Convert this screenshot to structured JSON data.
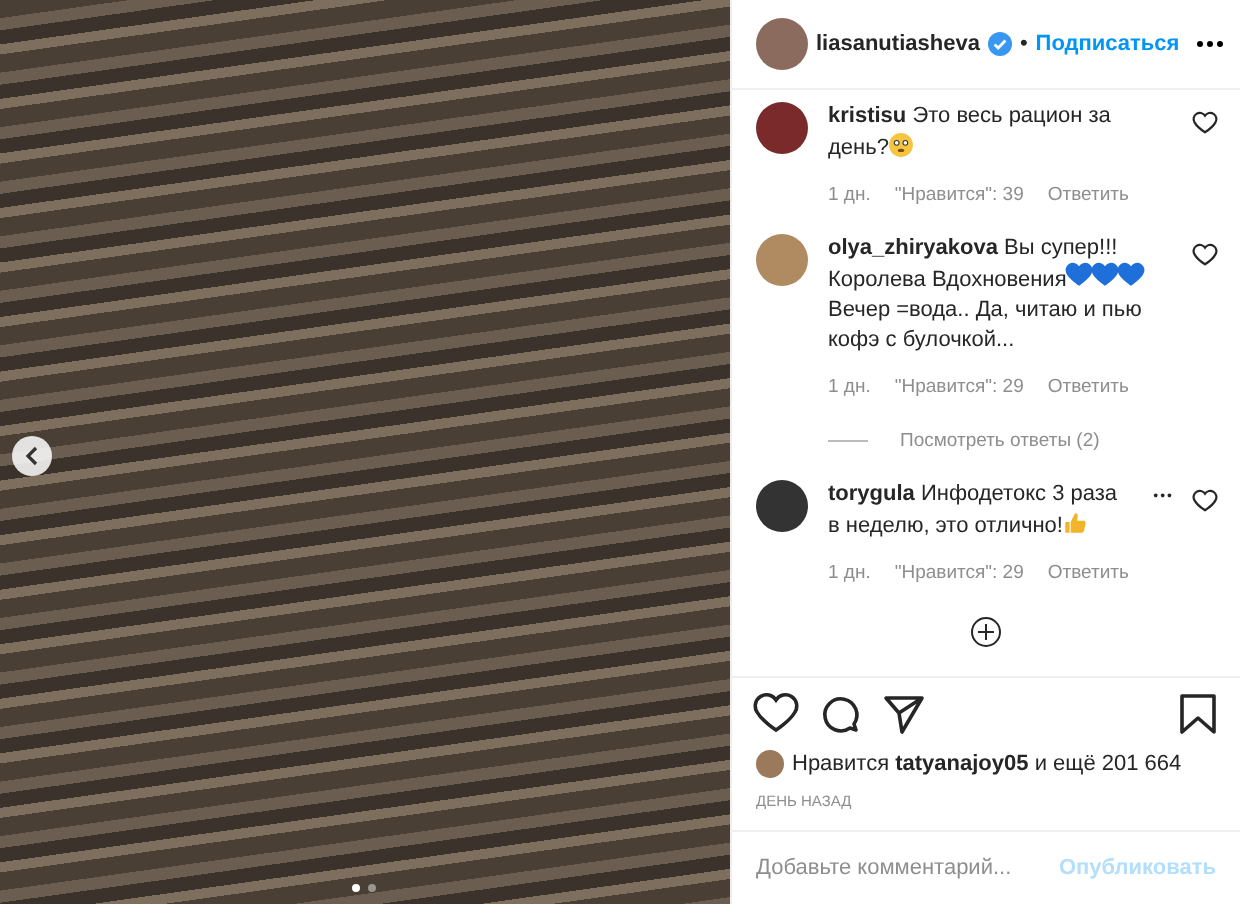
{
  "photo": {
    "dots": [
      {
        "selected": true
      },
      {
        "selected": false
      }
    ]
  },
  "header": {
    "username": "liasanutiasheva",
    "verified": true,
    "separator": "•",
    "follow": "Подписаться"
  },
  "comments": [
    {
      "username": "kristisu",
      "parts": [
        {
          "kind": "text",
          "text": "Это весь рацион за день?"
        },
        {
          "kind": "face"
        }
      ],
      "time": "1 дн.",
      "likes": "\"Нравится\": 39",
      "reply": "Ответить",
      "liked": false
    },
    {
      "username": "olya_zhiryakova",
      "parts": [
        {
          "kind": "text",
          "text": "Вы супер!!! Королева Вдохновения"
        },
        {
          "kind": "heart"
        },
        {
          "kind": "heart"
        },
        {
          "kind": "heart"
        },
        {
          "kind": "text",
          "text": " Вечер =вода.. Да, читаю и пью кофэ с булочкой..."
        }
      ],
      "time": "1 дн.",
      "likes": "\"Нравится\": 29",
      "reply": "Ответить",
      "liked": false,
      "view_replies": "Посмотреть ответы (2)"
    },
    {
      "username": "torygula",
      "parts": [
        {
          "kind": "text",
          "text": "Инфодетокс 3 раза в неделю, это отлично!"
        },
        {
          "kind": "thumbs"
        }
      ],
      "time": "1 дн.",
      "likes": "\"Нравится\": 29",
      "reply": "Ответить",
      "liked": false,
      "more": "•••"
    }
  ],
  "likes_line": {
    "prefix": "Нравится",
    "user": "tatyanajoy05",
    "suffix": "и ещё 201 664"
  },
  "posted": "ДЕНЬ НАЗАД",
  "comment_field": {
    "placeholder": "Добавьте комментарий...",
    "publish": "Опубликовать"
  }
}
